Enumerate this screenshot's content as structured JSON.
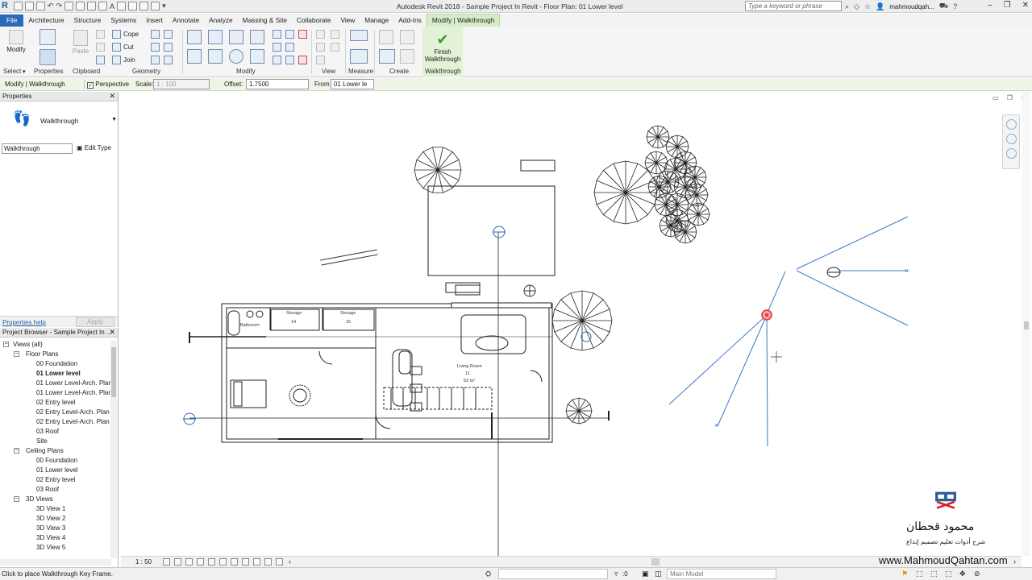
{
  "app": {
    "title": "Autodesk Revit 2018 -    Sample Project In Revit - Floor Plan: 01 Lower level",
    "logo_letter": "R",
    "search_placeholder": "Type a keyword or phrase",
    "user": "mahmoudqah...",
    "accent": "#2b6ab8",
    "contextual_tab_color": "#d7ecc6"
  },
  "ribbon_tabs": [
    "File",
    "Architecture",
    "Structure",
    "Systems",
    "Insert",
    "Annotate",
    "Analyze",
    "Massing & Site",
    "Collaborate",
    "View",
    "Manage",
    "Add-Ins",
    "Modify | Walkthrough"
  ],
  "ribbon": {
    "modify_label": "Modify",
    "paste_label": "Paste",
    "cope_label": "Cope",
    "cut_label": "Cut",
    "join_label": "Join",
    "finish_line1": "Finish",
    "finish_line2": "Walkthrough",
    "panels": {
      "select": "Select",
      "properties": "Properties",
      "clipboard": "Clipboard",
      "geometry": "Geometry",
      "modify": "Modify",
      "view": "View",
      "measure": "Measure",
      "create": "Create",
      "walkthrough": "Walkthrough"
    }
  },
  "options_bar": {
    "context": "Modify | Walkthrough",
    "perspective_label": "Perspective",
    "perspective_checked": true,
    "scale_label": "Scale:",
    "scale_value": "1 : 100",
    "offset_label": "Offset:",
    "offset_value": "1.7500",
    "from_label": "From",
    "from_value": "01 Lower le"
  },
  "properties": {
    "header": "Properties",
    "type_name": "Walkthrough",
    "filter_value": "Walkthrough",
    "edit_type": "Edit Type",
    "help_link": "Properties help",
    "apply": "Apply"
  },
  "browser": {
    "header": "Project Browser - Sample Project In ...",
    "rows": [
      {
        "label": "Views (all)",
        "level": 0,
        "toggle": "−"
      },
      {
        "label": "Floor Plans",
        "level": 1,
        "toggle": "−"
      },
      {
        "label": "00 Foundation",
        "level": 2
      },
      {
        "label": "01 Lower level",
        "level": 2,
        "bold": true
      },
      {
        "label": "01 Lower Level-Arch. Plan",
        "level": 2
      },
      {
        "label": "01 Lower Level-Arch. Plan",
        "level": 2
      },
      {
        "label": "02 Entry level",
        "level": 2
      },
      {
        "label": "02 Entry Level-Arch. Plan",
        "level": 2
      },
      {
        "label": "02 Entry Level-Arch. Plan",
        "level": 2
      },
      {
        "label": "03 Roof",
        "level": 2
      },
      {
        "label": "Site",
        "level": 2
      },
      {
        "label": "Ceiling Plans",
        "level": 1,
        "toggle": "−"
      },
      {
        "label": "00 Foundation",
        "level": 2
      },
      {
        "label": "01 Lower level",
        "level": 2
      },
      {
        "label": "02 Entry level",
        "level": 2
      },
      {
        "label": "03 Roof",
        "level": 2
      },
      {
        "label": "3D Views",
        "level": 1,
        "toggle": "−"
      },
      {
        "label": "3D View 1",
        "level": 2
      },
      {
        "label": "3D View 2",
        "level": 2
      },
      {
        "label": "3D View 3",
        "level": 2
      },
      {
        "label": "3D View 4",
        "level": 2
      },
      {
        "label": "3D View 5",
        "level": 2
      }
    ]
  },
  "drawing": {
    "rooms": {
      "bathroom": "Bathroom",
      "storage1": "Storage",
      "storage2": "Storage",
      "living": "Living Room",
      "living_area": "53 m²",
      "storage1_num": "14",
      "storage2_num": "15",
      "living_num": "11"
    },
    "walkthrough_color": "#3b78c9",
    "keyframe_color": "#e0313a"
  },
  "view_bar": {
    "scale": "1 : 50"
  },
  "status": {
    "message": "Click to place Walkthrough Key Frame.",
    "zero": ":0",
    "model": "Main Model"
  },
  "watermark": {
    "arabic": "محمود قحطان",
    "tagline": "شرح أدوات تعليم تصميم إبداع",
    "url": "www.MahmoudQahtan.com"
  }
}
